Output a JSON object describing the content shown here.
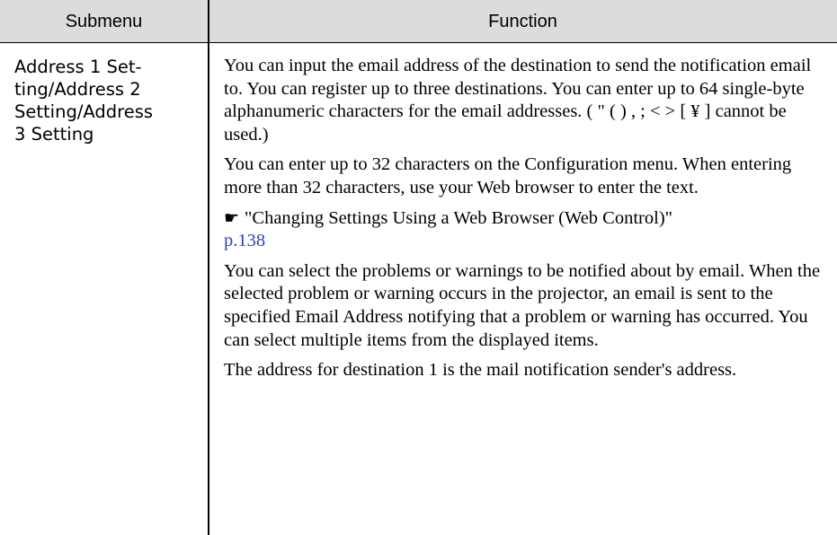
{
  "header": {
    "submenu": "Submenu",
    "function": "Function"
  },
  "row": {
    "submenu_text": "Address 1 Set-\nting/Address 2\nSetting/Address\n3 Setting",
    "para1": "You can input the email address of the destination to send the notification email to. You can register up to three destinations. You can enter up to 64 single-byte alphanumeric characters for the email addresses. ( \" ( ) , ; < > [ ¥ ] cannot be used.)",
    "para2": "You can enter up to 32 characters on the Configuration menu. When entering more than 32 characters, use your Web browser to enter the text.",
    "ref_text": "\"Changing Settings Using a Web Browser (Web Control)\"",
    "ref_page": "p.138",
    "para3": "You can select the problems or warnings to be notified about by email. When the selected problem or warning occurs in the projector, an email is sent to the specified Email Address notifying that a problem or warning has occurred. You can select multiple items from the displayed items.",
    "para4": "The address for destination 1 is the mail notification sender's address."
  },
  "icons": {
    "pointer": "pointing-hand-icon"
  },
  "colors": {
    "header_bg": "#dcdcdc",
    "link": "#2a3ec7"
  }
}
